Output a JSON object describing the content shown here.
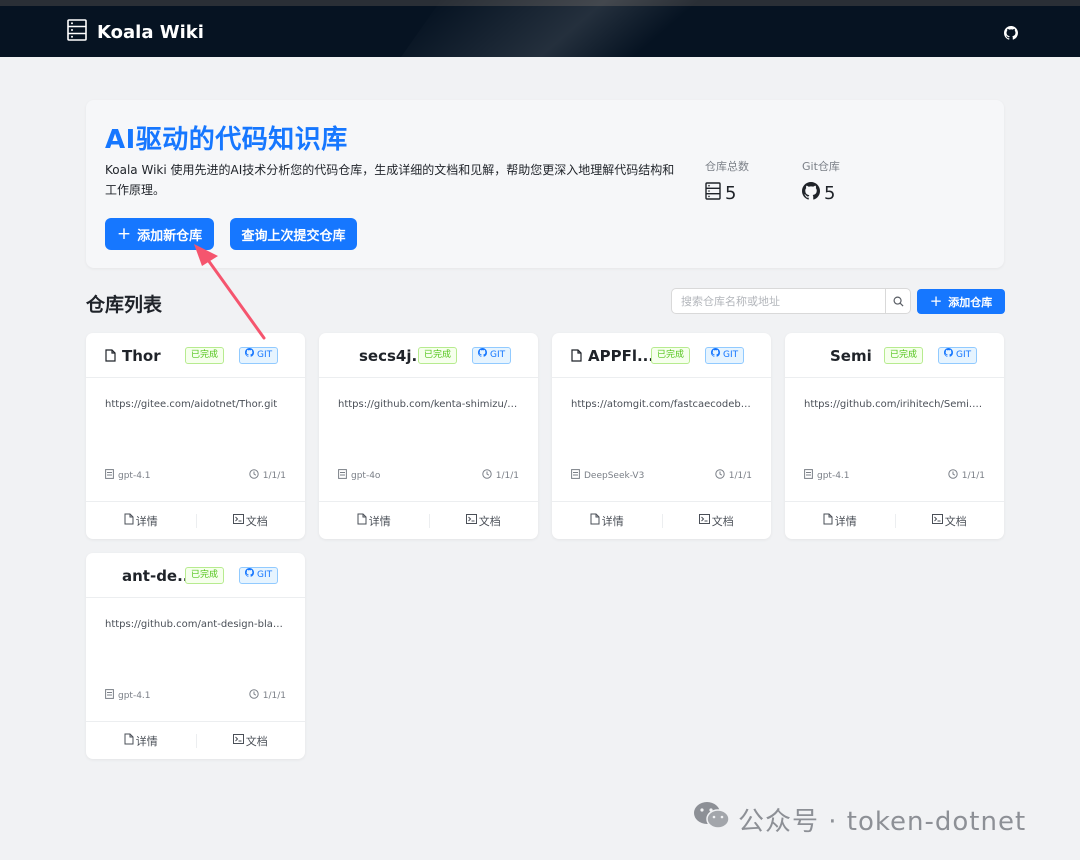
{
  "app": {
    "title": "Koala Wiki"
  },
  "hero": {
    "title": "AI驱动的代码知识库",
    "description": "Koala Wiki 使用先进的AI技术分析您的代码仓库，生成详细的文档和见解，帮助您更深入地理解代码结构和工作原理。",
    "add_button": "添加新仓库",
    "query_button": "查询上次提交仓库",
    "stats": {
      "total_label": "仓库总数",
      "total_value": "5",
      "git_label": "Git仓库",
      "git_value": "5"
    }
  },
  "list": {
    "title": "仓库列表",
    "search_placeholder": "搜索仓库名称或地址",
    "add_button": "添加仓库"
  },
  "repos": [
    {
      "name": "Thor",
      "status": "已完成",
      "type": "GIT",
      "url": "https://gitee.com/aidotnet/Thor.git",
      "model": "gpt-4.1",
      "date": "1/1/1",
      "detail_label": "详情",
      "doc_label": "文档",
      "show_file_icon": true
    },
    {
      "name": "secs4j...",
      "status": "已完成",
      "type": "GIT",
      "url": "https://github.com/kenta-shimizu/sec...",
      "model": "gpt-4o",
      "date": "1/1/1",
      "detail_label": "详情",
      "doc_label": "文档",
      "show_file_icon": false
    },
    {
      "name": "APPFl...",
      "status": "已完成",
      "type": "GIT",
      "url": "https://atomgit.com/fastcaecodebase...",
      "model": "DeepSeek-V3",
      "date": "1/1/1",
      "detail_label": "详情",
      "doc_label": "文档",
      "show_file_icon": true
    },
    {
      "name": "Semi",
      "status": "已完成",
      "type": "GIT",
      "url": "https://github.com/irihitech/Semi.Ava...",
      "model": "gpt-4.1",
      "date": "1/1/1",
      "detail_label": "详情",
      "doc_label": "文档",
      "show_file_icon": false
    },
    {
      "name": "ant-de...",
      "status": "已完成",
      "type": "GIT",
      "url": "https://github.com/ant-design-blazor...",
      "model": "gpt-4.1",
      "date": "1/1/1",
      "detail_label": "详情",
      "doc_label": "文档",
      "show_file_icon": false
    }
  ],
  "watermark": {
    "text": "公众号 · token-dotnet"
  },
  "colors": {
    "primary": "#1677ff",
    "header_bg": "#061322",
    "success": "#52c41a",
    "annotation_arrow": "#f5556e"
  }
}
